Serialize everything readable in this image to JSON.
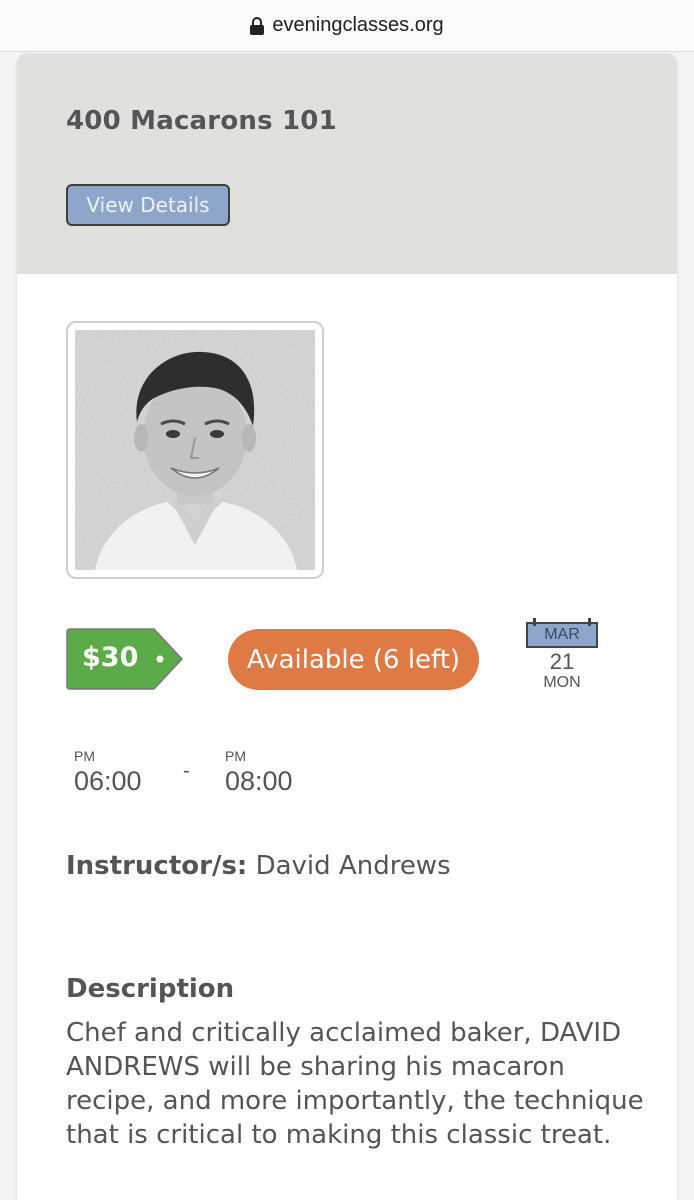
{
  "browser": {
    "url": "eveningclasses.org"
  },
  "course": {
    "title": "400 Macarons 101",
    "details_button": "View Details",
    "price": "$30",
    "availability": "Available (6 left)",
    "date": {
      "month": "MAR",
      "day": "21",
      "weekday": "MON"
    },
    "start": {
      "ampm": "PM",
      "time": "06:00"
    },
    "separator": "-",
    "end": {
      "ampm": "PM",
      "time": "08:00"
    },
    "instructor_label": "Instructor/s:",
    "instructor_name": "David Andrews",
    "description_title": "Description",
    "description": "Chef and critically acclaimed baker, DAVID ANDREWS will be sharing his macaron recipe, and more importantly, the technique that is critical to making this classic treat."
  },
  "colors": {
    "header_bg": "#e0e0df",
    "button_bg": "#8da6c9",
    "price_green": "#5bab48",
    "available_orange": "#e07a44"
  }
}
